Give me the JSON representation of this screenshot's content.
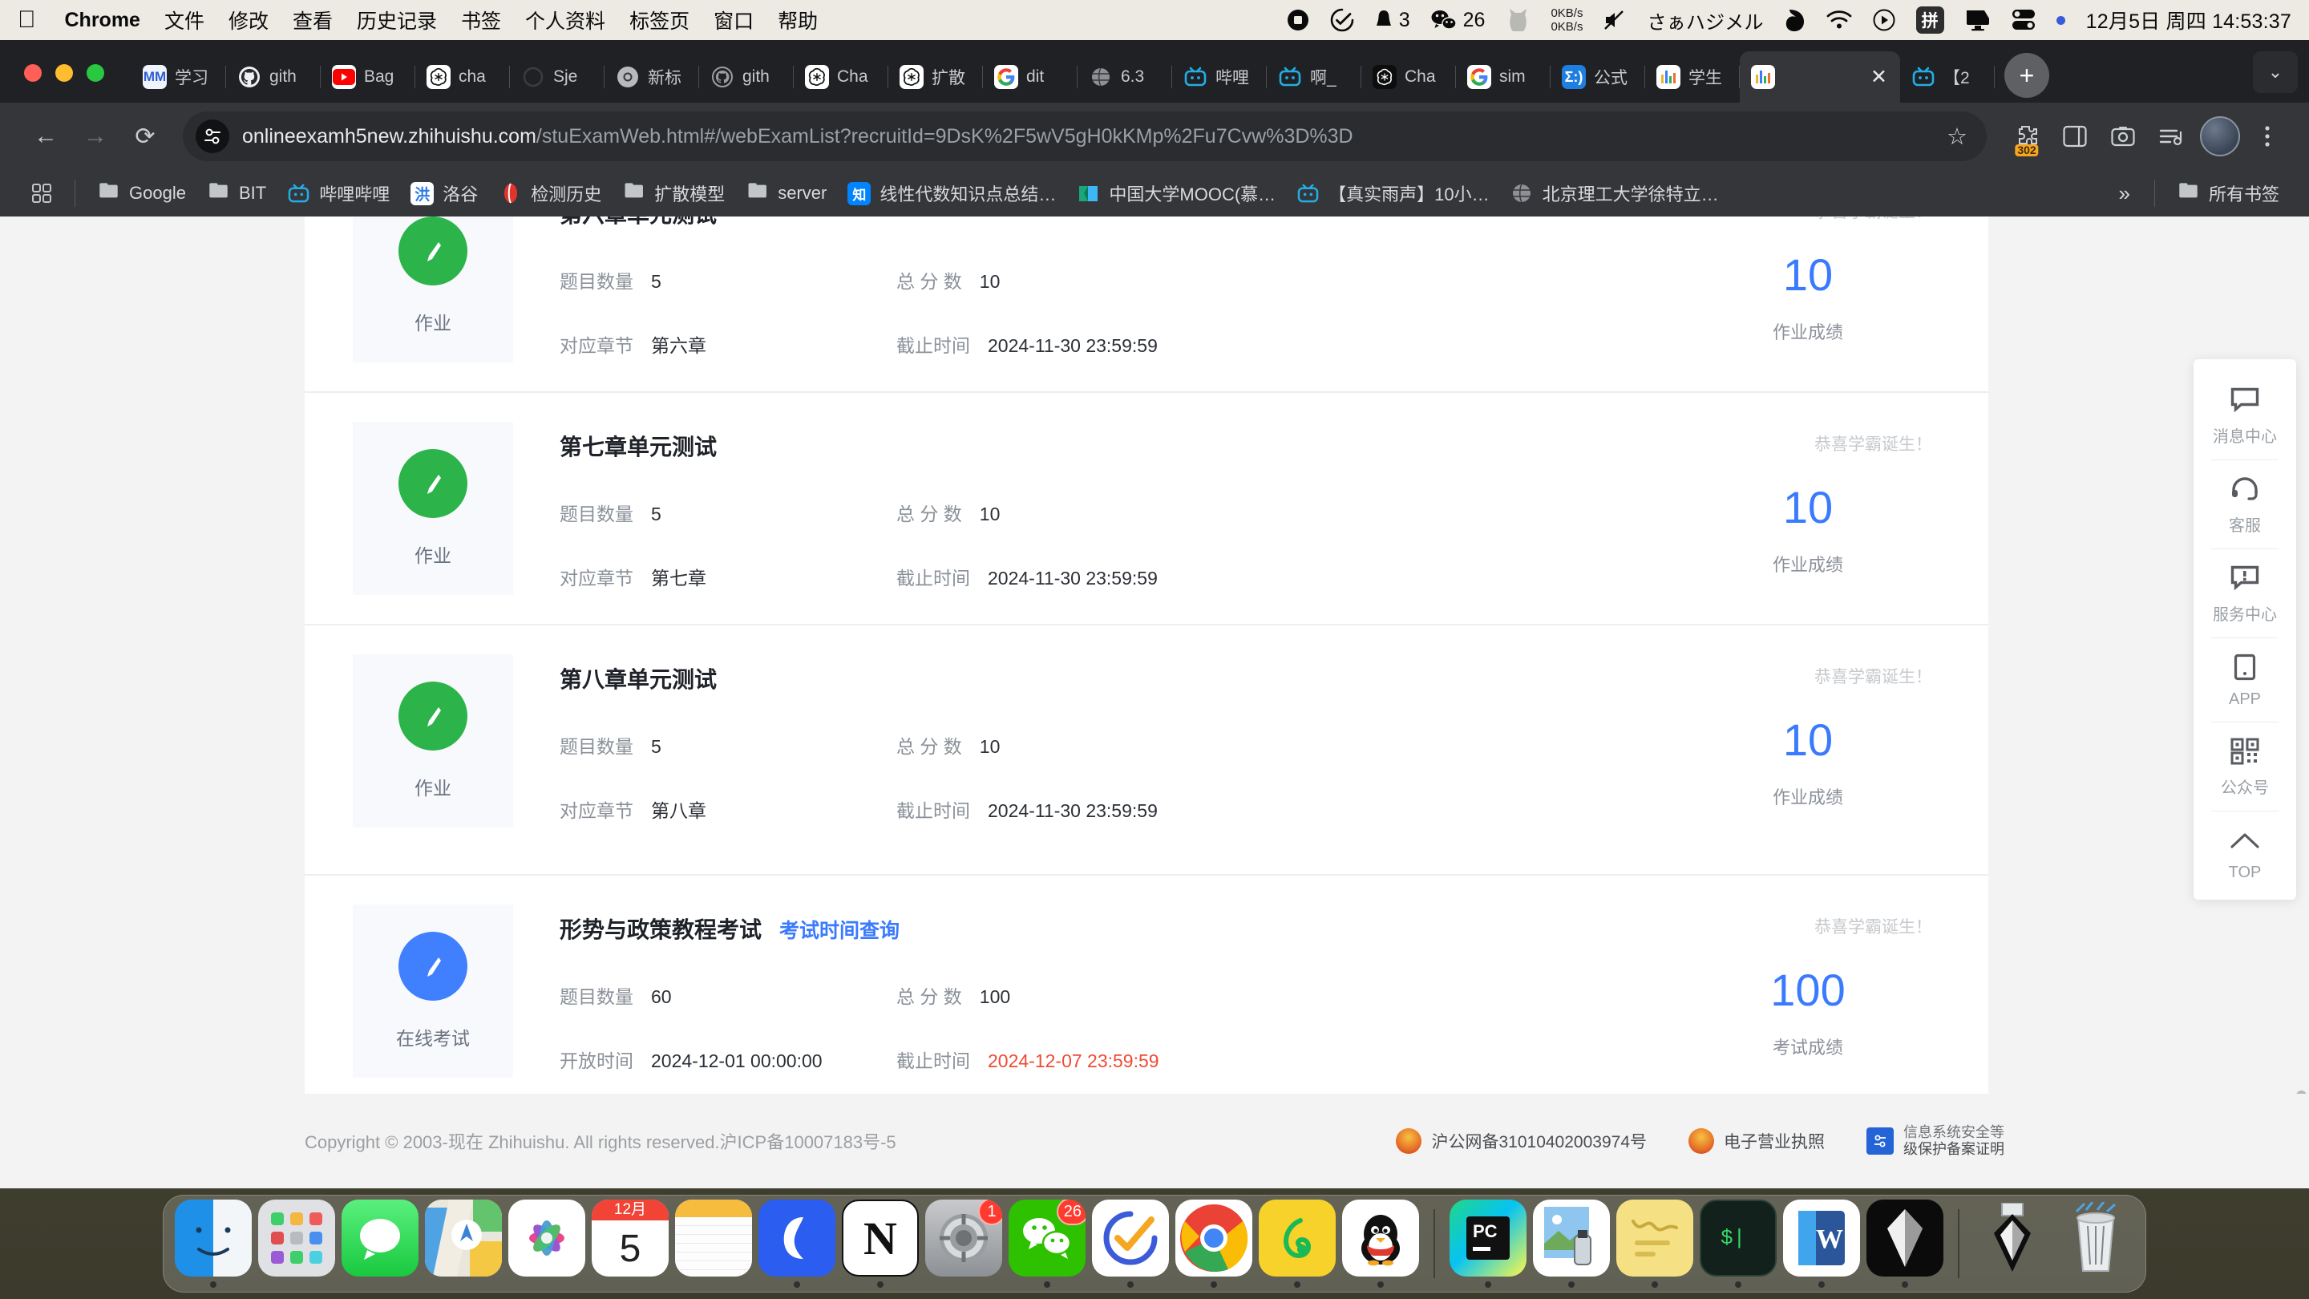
{
  "menubar": {
    "apple": "",
    "app_name": "Chrome",
    "items": [
      "文件",
      "修改",
      "查看",
      "历史记录",
      "书签",
      "个人资料",
      "标签页",
      "窗口",
      "帮助"
    ],
    "status_icons": [
      "stop-record-icon",
      "checkmark-circle-icon"
    ],
    "notification_count": "3",
    "wechat_count": "26",
    "net_up": "0KB/s",
    "net_down": "0KB/s",
    "ime_text": "さぁハジメル",
    "ime_badge": "拼",
    "clock": "12月5日 周四  14:53:37"
  },
  "browser": {
    "tabs": [
      {
        "label": "学习",
        "icon": "mm-icon",
        "active": false
      },
      {
        "label": "gith",
        "icon": "github-icon",
        "active": false
      },
      {
        "label": "Bag",
        "icon": "youtube-icon",
        "active": false
      },
      {
        "label": "cha",
        "icon": "openai-icon",
        "active": false
      },
      {
        "label": "Sje",
        "icon": "generic-icon",
        "active": false
      },
      {
        "label": "新标",
        "icon": "chrome-icon",
        "active": false
      },
      {
        "label": "gith",
        "icon": "github-icon",
        "active": false
      },
      {
        "label": "Cha",
        "icon": "openai-icon",
        "active": false
      },
      {
        "label": "扩散",
        "icon": "openai-icon",
        "active": false
      },
      {
        "label": "dit",
        "icon": "google-icon",
        "active": false
      },
      {
        "label": "6.3",
        "icon": "globe-icon",
        "active": false
      },
      {
        "label": "哔哩",
        "icon": "bilibili-icon",
        "active": false
      },
      {
        "label": "啊_",
        "icon": "bilibili-icon",
        "active": false
      },
      {
        "label": "Cha",
        "icon": "openai-dark-icon",
        "active": false
      },
      {
        "label": "sim",
        "icon": "google-icon",
        "active": false
      },
      {
        "label": "公式",
        "icon": "sigma-icon",
        "active": false
      },
      {
        "label": "学生",
        "icon": "zhihuishu-icon",
        "active": false
      },
      {
        "label": "",
        "icon": "zhihuishu-icon",
        "active": true
      },
      {
        "label": "【2",
        "icon": "bilibili-icon",
        "active": false
      }
    ],
    "new_tab_label": "+",
    "tab_close_label": "✕",
    "tab_search_label": "⌄",
    "nav": {
      "back": "←",
      "forward": "→",
      "reload": "⟳"
    },
    "url_host": "onlineexamh5new.zhihuishu.com",
    "url_path": "/stuExamWeb.html#/webExamList?recruitId=9DsK%2F5wV5gH0kKMp%2Fu7Cvw%3D%3D",
    "bookmark_star": "☆",
    "extension_badge": "302",
    "bookmarks": [
      {
        "label": "Google",
        "icon": "folder-icon"
      },
      {
        "label": "BIT",
        "icon": "folder-icon"
      },
      {
        "label": "哔哩哔哩",
        "icon": "bilibili-icon"
      },
      {
        "label": "洛谷",
        "icon": "luogu-icon"
      },
      {
        "label": "检测历史",
        "icon": "redball-icon"
      },
      {
        "label": "扩散模型",
        "icon": "folder-icon"
      },
      {
        "label": "server",
        "icon": "folder-icon"
      },
      {
        "label": "线性代数知识点总结…",
        "icon": "zhihu-icon"
      },
      {
        "label": "中国大学MOOC(慕…",
        "icon": "mooc-icon"
      },
      {
        "label": "【真实雨声】10小…",
        "icon": "bilibili-icon"
      },
      {
        "label": "北京理工大学徐特立…",
        "icon": "globe-icon"
      }
    ],
    "bookmarks_overflow": "»",
    "all_bookmarks_label": "所有书签"
  },
  "page": {
    "labels": {
      "question_count": "题目数量",
      "total_score": "总 分 数",
      "chapter": "对应章节",
      "deadline": "截止时间",
      "open_time": "开放时间",
      "congrats": "恭喜学霸诞生！",
      "homework_score": "作业成绩",
      "exam_score": "考试成绩"
    },
    "exams": [
      {
        "type": "作业",
        "type_color": "#2cb34a",
        "title": "第六章单元测试",
        "link": "",
        "question_count": "5",
        "total_score": "10",
        "left_key": "对应章节",
        "left_value": "第六章",
        "deadline": "2024-11-30 23:59:59",
        "deadline_red": false,
        "score": "10",
        "score_label": "作业成绩",
        "congrats": "恭喜学霸诞生！",
        "second_left_key": "",
        "second_left_value": ""
      },
      {
        "type": "作业",
        "type_color": "#2cb34a",
        "title": "第七章单元测试",
        "link": "",
        "question_count": "5",
        "total_score": "10",
        "left_key": "对应章节",
        "left_value": "第七章",
        "deadline": "2024-11-30 23:59:59",
        "deadline_red": false,
        "score": "10",
        "score_label": "作业成绩",
        "congrats": "恭喜学霸诞生！",
        "second_left_key": "",
        "second_left_value": ""
      },
      {
        "type": "作业",
        "type_color": "#2cb34a",
        "title": "第八章单元测试",
        "link": "",
        "question_count": "5",
        "total_score": "10",
        "left_key": "对应章节",
        "left_value": "第八章",
        "deadline": "2024-11-30 23:59:59",
        "deadline_red": false,
        "score": "10",
        "score_label": "作业成绩",
        "congrats": "恭喜学霸诞生！",
        "second_left_key": "",
        "second_left_value": ""
      },
      {
        "type": "在线考试",
        "type_color": "#4080ff",
        "title": "形势与政策教程考试",
        "link": "考试时间查询",
        "question_count": "60",
        "total_score": "100",
        "left_key": "开放时间",
        "left_value": "2024-12-01 00:00:00",
        "deadline": "2024-12-07 23:59:59",
        "deadline_red": true,
        "score": "100",
        "score_label": "考试成绩",
        "congrats": "恭喜学霸诞生！",
        "second_left_key": "",
        "second_left_value": ""
      }
    ],
    "side_panel": [
      {
        "label": "消息中心",
        "icon": "message-icon"
      },
      {
        "label": "客服",
        "icon": "headset-icon"
      },
      {
        "label": "服务中心",
        "icon": "service-icon"
      },
      {
        "label": "APP",
        "icon": "phone-icon"
      },
      {
        "label": "公众号",
        "icon": "qrcode-icon"
      },
      {
        "label": "TOP",
        "icon": "arrow-up-icon"
      }
    ],
    "footer": {
      "copyright": "Copyright © 2003-现在 Zhihuishu. All rights reserved.沪ICP备10007183号-5",
      "police_record": "沪公网备31010402003974号",
      "business_license": "电子营业执照",
      "security_line1": "信息系统安全等",
      "security_line2": "级保护备案证明"
    }
  },
  "dock": {
    "apps": [
      {
        "name": "finder",
        "badge": "",
        "running": true
      },
      {
        "name": "launchpad",
        "badge": "",
        "running": false
      },
      {
        "name": "messages",
        "badge": "",
        "running": false
      },
      {
        "name": "maps",
        "badge": "",
        "running": false
      },
      {
        "name": "photos",
        "badge": "",
        "running": false
      },
      {
        "name": "calendar",
        "badge": "",
        "running": false,
        "month": "12月",
        "day": "5"
      },
      {
        "name": "notes",
        "badge": "",
        "running": false
      },
      {
        "name": "quark",
        "badge": "",
        "running": true
      },
      {
        "name": "notion",
        "badge": "",
        "running": true
      },
      {
        "name": "settings",
        "badge": "1",
        "running": false
      },
      {
        "name": "wechat",
        "badge": "26",
        "running": true
      },
      {
        "name": "todo",
        "badge": "",
        "running": true
      },
      {
        "name": "chrome",
        "badge": "",
        "running": true
      },
      {
        "name": "netease-music",
        "badge": "",
        "running": true
      },
      {
        "name": "qq",
        "badge": "",
        "running": true
      },
      {
        "name": "pycharm",
        "badge": "",
        "running": true
      },
      {
        "name": "preview",
        "badge": "",
        "running": true
      },
      {
        "name": "stickies",
        "badge": "",
        "running": true
      },
      {
        "name": "terminal",
        "badge": "",
        "running": true
      },
      {
        "name": "word",
        "badge": "",
        "running": true
      },
      {
        "name": "unknown-black",
        "badge": "",
        "running": true
      },
      {
        "name": "downloads",
        "badge": "",
        "running": false
      },
      {
        "name": "trash",
        "badge": "",
        "running": false
      }
    ]
  }
}
